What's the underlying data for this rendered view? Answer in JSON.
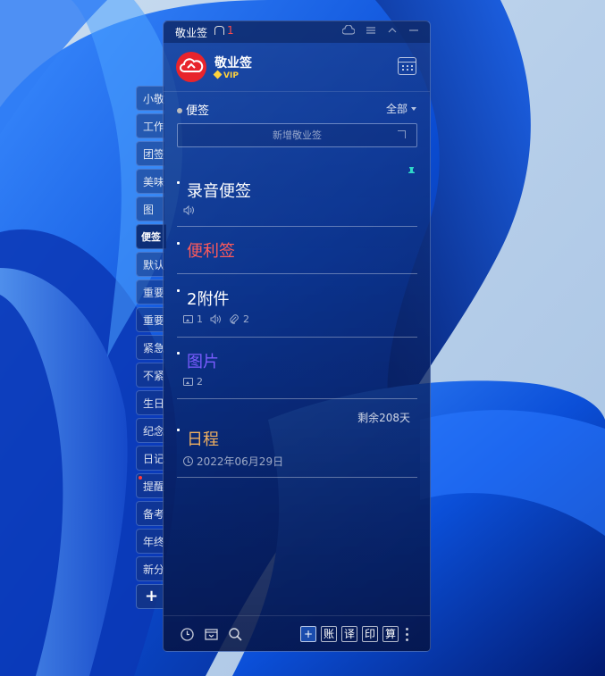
{
  "window": {
    "title": "敬业签",
    "notification_count": "1"
  },
  "user": {
    "app_name": "敬业签",
    "badge": "VIP"
  },
  "side_tabs": [
    {
      "label": "小敬"
    },
    {
      "label": "工作"
    },
    {
      "label": "团签"
    },
    {
      "label": "美味"
    },
    {
      "label": "图"
    },
    {
      "label": "便签",
      "active": true
    },
    {
      "label": "默认"
    },
    {
      "label": "重要"
    },
    {
      "label": "重要"
    },
    {
      "label": "紧急"
    },
    {
      "label": "不紧"
    },
    {
      "label": "生日"
    },
    {
      "label": "纪念"
    },
    {
      "label": "日记"
    },
    {
      "label": "提醒",
      "dot": true
    },
    {
      "label": "备考"
    },
    {
      "label": "年终"
    },
    {
      "label": "新分"
    }
  ],
  "side_add_label": "+",
  "section": {
    "title": "便签",
    "filter": "全部"
  },
  "new_note": {
    "placeholder": "新增敬业签"
  },
  "notes": [
    {
      "title": "录音便签",
      "color": "#ffffff"
    },
    {
      "title": "便利签",
      "color": "#ff5a5a"
    },
    {
      "title": "2附件",
      "color": "#ffffff",
      "images": "1",
      "attachments": "2"
    },
    {
      "title": "图片",
      "color": "#7a5cff",
      "images": "2"
    },
    {
      "title": "日程",
      "color": "#f0b060",
      "date": "2022年06月29日",
      "remaining": "剩余208天"
    }
  ],
  "toolbar": {
    "buttons": [
      "+",
      "账",
      "译",
      "印",
      "算"
    ]
  },
  "colors": {
    "logo": "#e8242c",
    "vip": "#ffd23c",
    "pin": "#2fd8c8"
  }
}
